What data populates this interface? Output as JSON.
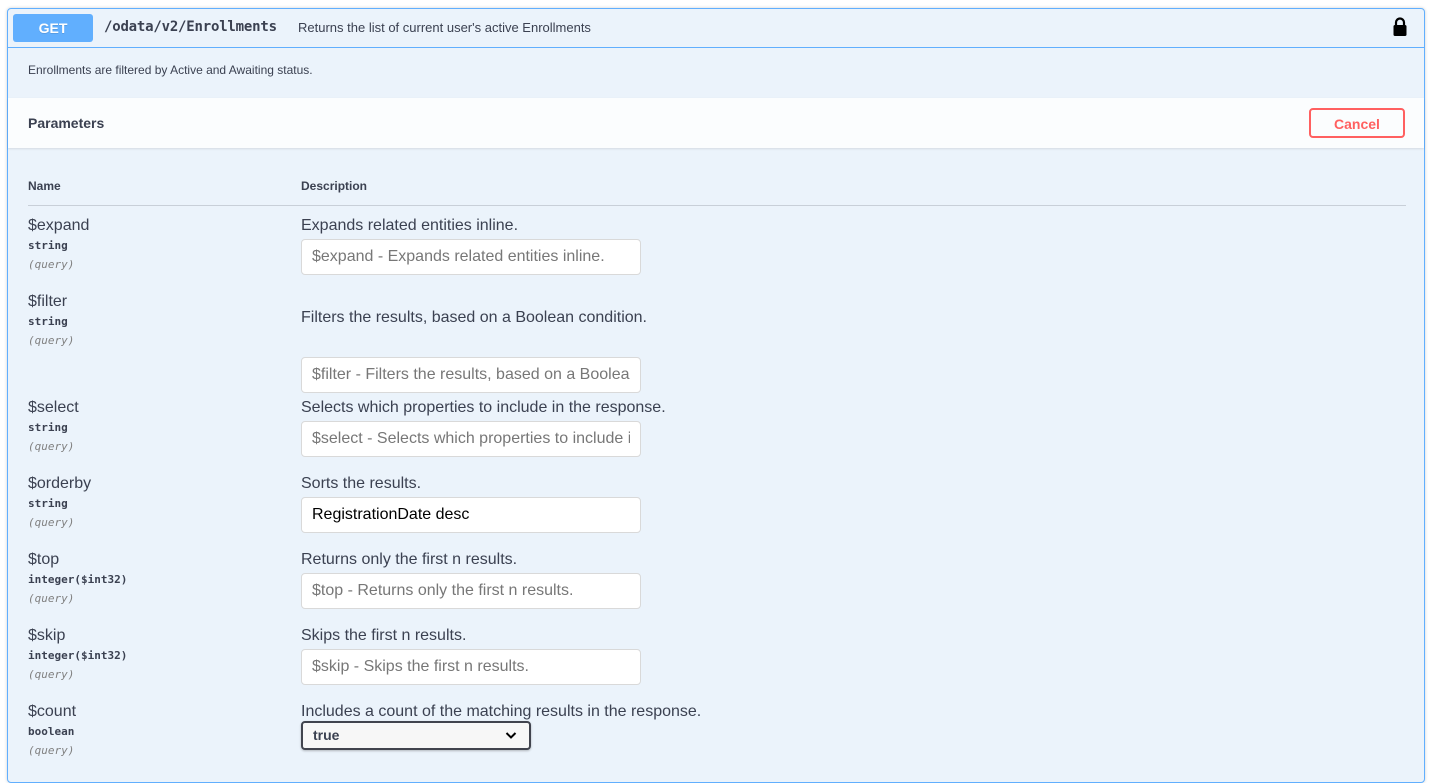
{
  "endpoint": {
    "method": "GET",
    "path": "/odata/v2/Enrollments",
    "summary": "Returns the list of current user's active Enrollments",
    "description": "Enrollments are filtered by Active and Awaiting status.",
    "lock_icon": "lock-icon"
  },
  "parameters_section": {
    "title": "Parameters",
    "cancel_label": "Cancel",
    "col_name": "Name",
    "col_description": "Description"
  },
  "params": [
    {
      "name": "$expand",
      "type": "string",
      "in": "(query)",
      "description": "Expands related entities inline.",
      "placeholder": "$expand - Expands related entities inline.",
      "value": ""
    },
    {
      "name": "$filter",
      "type": "string",
      "in": "(query)",
      "description": "Filters the results, based on a Boolean condition.",
      "placeholder": "$filter - Filters the results, based on a Boolean condition.",
      "value": ""
    },
    {
      "name": "$select",
      "type": "string",
      "in": "(query)",
      "description": "Selects which properties to include in the response.",
      "placeholder": "$select - Selects which properties to include in the response.",
      "value": ""
    },
    {
      "name": "$orderby",
      "type": "string",
      "in": "(query)",
      "description": "Sorts the results.",
      "placeholder": "$orderby - Sorts the results.",
      "value": "RegistrationDate desc"
    },
    {
      "name": "$top",
      "type": "integer($int32)",
      "in": "(query)",
      "description": "Returns only the first n results.",
      "placeholder": "$top - Returns only the first n results.",
      "value": ""
    },
    {
      "name": "$skip",
      "type": "integer($int32)",
      "in": "(query)",
      "description": "Skips the first n results.",
      "placeholder": "$skip - Skips the first n results.",
      "value": ""
    },
    {
      "name": "$count",
      "type": "boolean",
      "in": "(query)",
      "description": "Includes a count of the matching results in the response.",
      "selected": "true"
    }
  ],
  "colors": {
    "get_blue": "#61affe",
    "cancel_red": "#ff6060",
    "block_bg": "#ebf3fb"
  }
}
